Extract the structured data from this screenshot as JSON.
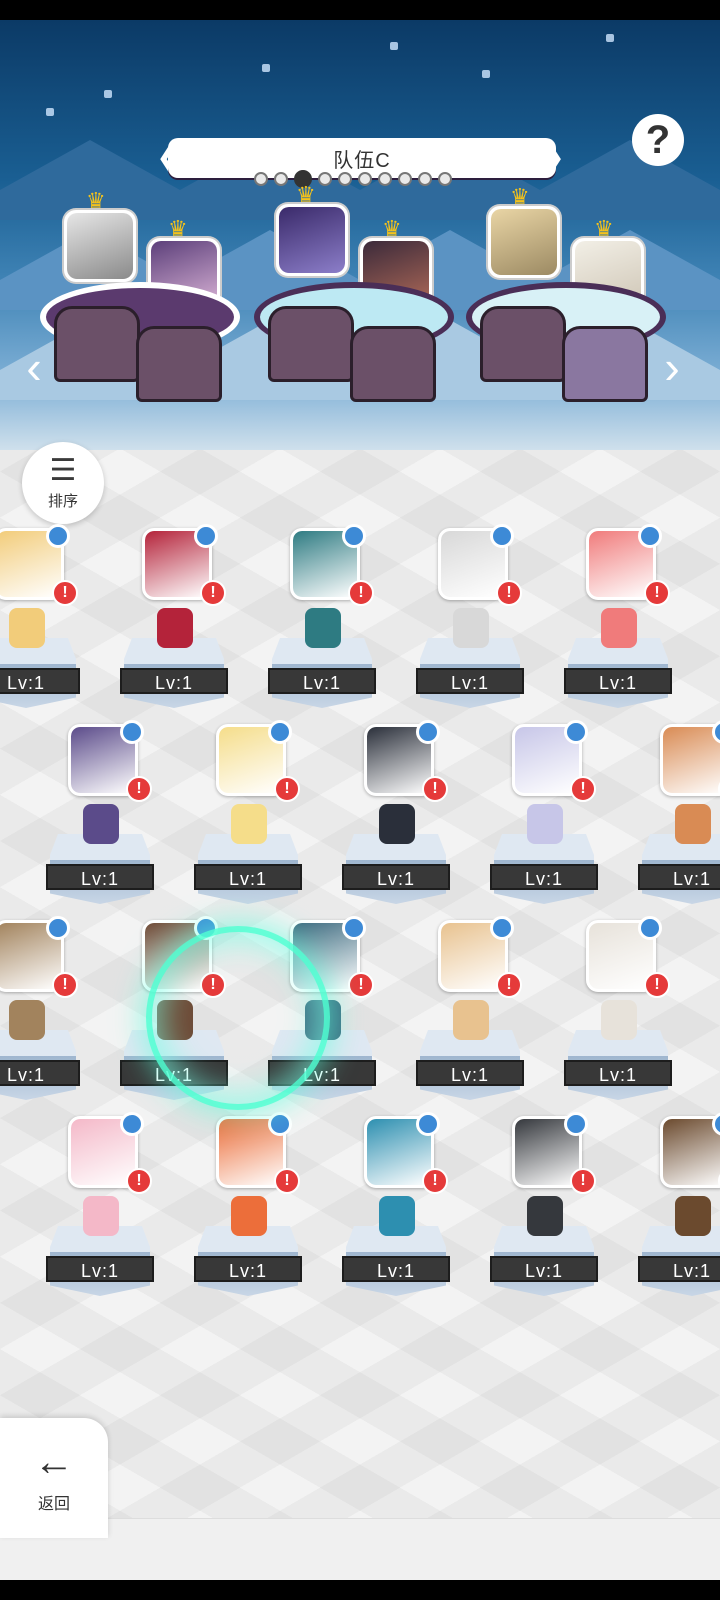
{
  "team": {
    "name": "队伍C",
    "page_count": 10,
    "active_page": 3
  },
  "buttons": {
    "sort": "排序",
    "back": "返回",
    "help": "?"
  },
  "icons": {
    "help": "question-mark-icon",
    "sort": "sort-descending-icon",
    "back": "arrow-left-icon",
    "prev": "chevron-left-icon",
    "next": "chevron-right-icon"
  },
  "team_slots": [
    {
      "members": 2,
      "base_color": "#5b3a6e",
      "style": "dark"
    },
    {
      "members": 2,
      "base_color": "#bde9f3",
      "style": "light"
    },
    {
      "members": 2,
      "base_color": "#d8f1f6",
      "style": "light"
    }
  ],
  "heroes": [
    {
      "level": "Lv:1",
      "color": "#f2cc7a"
    },
    {
      "level": "Lv:1",
      "color": "#b4233a"
    },
    {
      "level": "Lv:1",
      "color": "#2e7b82"
    },
    {
      "level": "Lv:1",
      "color": "#d8d8d8"
    },
    {
      "level": "Lv:1",
      "color": "#f07b7b"
    },
    {
      "level": "Lv:1",
      "color": "#5b4b8a"
    },
    {
      "level": "Lv:1",
      "color": "#f5dd8a"
    },
    {
      "level": "Lv:1",
      "color": "#2a2f3a"
    },
    {
      "level": "Lv:1",
      "color": "#c7c6e8"
    },
    {
      "level": "Lv:1",
      "color": "#d98b54"
    },
    {
      "level": "Lv:1",
      "color": "#a2835d"
    },
    {
      "level": "Lv:1",
      "color": "#6f4b37"
    },
    {
      "level": "Lv:1",
      "color": "#3d6a7f"
    },
    {
      "level": "Lv:1",
      "color": "#e8c28f"
    },
    {
      "level": "Lv:1",
      "color": "#e7e2da"
    },
    {
      "level": "Lv:1",
      "color": "#f4b8c8"
    },
    {
      "level": "Lv:1",
      "color": "#ec6e3a"
    },
    {
      "level": "Lv:1",
      "color": "#2d8fb0"
    },
    {
      "level": "Lv:1",
      "color": "#35383d"
    },
    {
      "level": "Lv:1",
      "color": "#6b4a2e"
    }
  ]
}
